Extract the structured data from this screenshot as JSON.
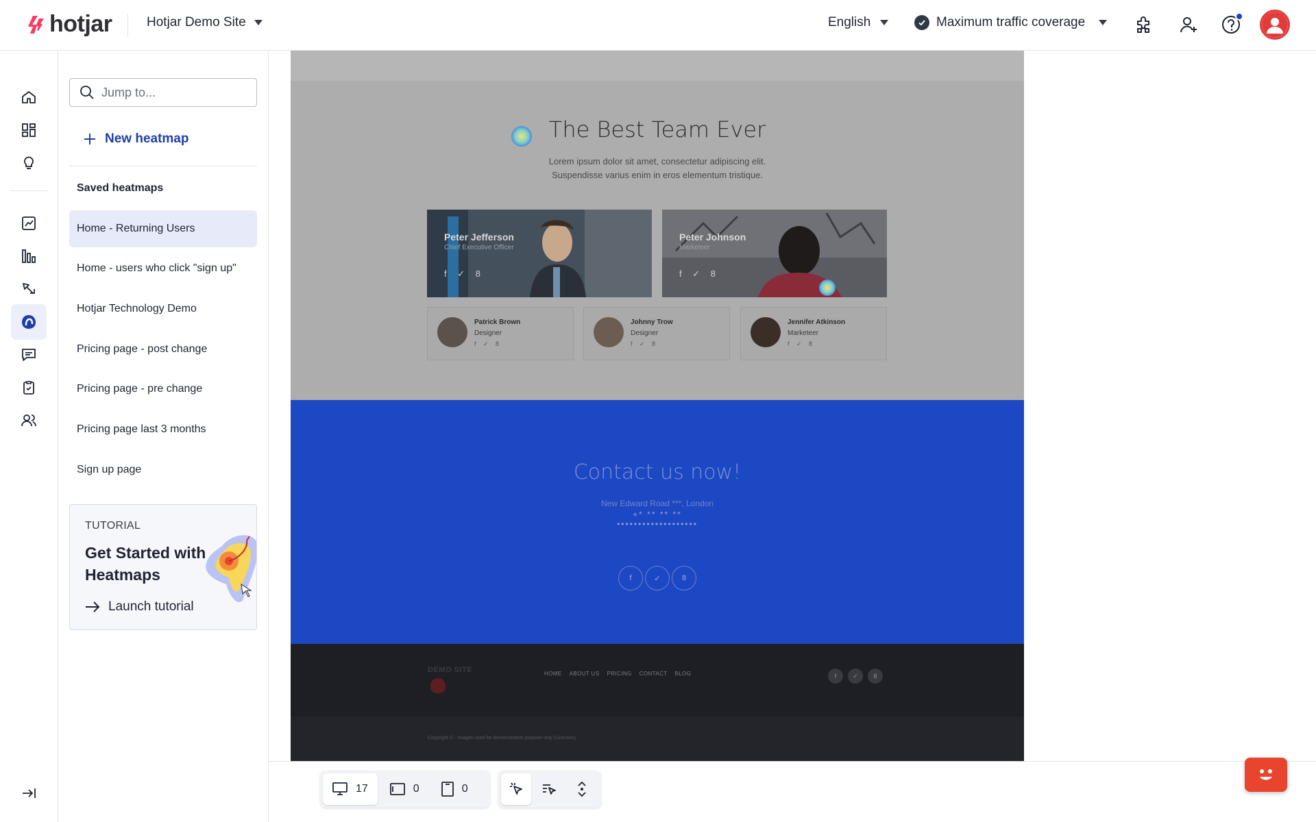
{
  "brand": {
    "name": "hotjar",
    "accent": "#fd3a5c"
  },
  "topbar": {
    "site_name": "Hotjar Demo Site",
    "language": "English",
    "traffic": "Maximum traffic coverage"
  },
  "sidebar": {
    "search_placeholder": "Jump to...",
    "new_heatmap": "New heatmap",
    "saved_heading": "Saved heatmaps",
    "items": [
      {
        "label": "Home - Returning Users",
        "active": true
      },
      {
        "label": "Home - users who click \"sign up\""
      },
      {
        "label": "Hotjar Technology Demo"
      },
      {
        "label": "Pricing page - post change"
      },
      {
        "label": "Pricing page - pre change"
      },
      {
        "label": "Pricing page last 3 months"
      },
      {
        "label": "Sign up page"
      }
    ],
    "tutorial": {
      "tag": "TUTORIAL",
      "title": "Get Started with Heatmaps",
      "action": "Launch tutorial"
    }
  },
  "page": {
    "team_title": "The Best Team Ever",
    "team_sub_1": "Lorem ipsum dolor sit amet, consectetur adipiscing elit.",
    "team_sub_2": "Suspendisse varius enim in eros elementum tristique.",
    "cards_big": [
      {
        "name": "Peter Jefferson",
        "role": "Chief Executive Officer"
      },
      {
        "name": "Peter Johnson",
        "role": "Marketeer"
      }
    ],
    "cards_small": [
      {
        "name": "Patrick Brown",
        "role": "Designer"
      },
      {
        "name": "Johnny Trow",
        "role": "Designer"
      },
      {
        "name": "Jennifer Atkinson",
        "role": "Marketeer"
      }
    ],
    "social": "f ✓ 8",
    "contact_title": "Contact us now!",
    "contact_address": "New Edward Road ***, London",
    "contact_masked_1": "+* ** ** **",
    "contact_masked_2": "•••••••••••••••••••",
    "footer_brand": "DEMO SITE",
    "footer_nav": [
      "HOME",
      "ABOUT US",
      "PRICING",
      "CONTACT",
      "BLOG"
    ],
    "copyright": "Copyright © - Images used for demonstration purpose only (Licenses)"
  },
  "toolbar": {
    "desktop_count": "17",
    "tablet_count": "0",
    "mobile_count": "0"
  }
}
